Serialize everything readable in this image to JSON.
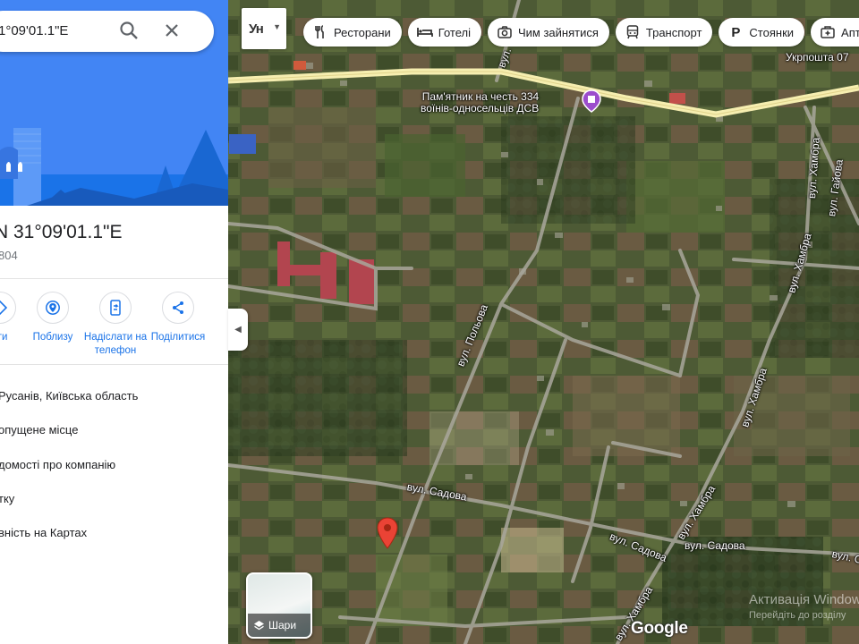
{
  "search": {
    "query": "1°09'01.1\"E"
  },
  "place": {
    "title": "N 31°09'01.1\"E",
    "subtitle": "804"
  },
  "actions": [
    {
      "label": "тти",
      "icon": "directions-icon"
    },
    {
      "label": "Поблизу",
      "icon": "nearby-icon"
    },
    {
      "label": "Надіслати на телефон",
      "icon": "send-to-phone-icon"
    },
    {
      "label": "Поділитися",
      "icon": "share-icon"
    }
  ],
  "info": [
    "Русанів, Київська область",
    "опущене місце",
    "домості про компанію",
    "тку",
    "вність на Картах"
  ],
  "toolbar": {
    "lang": "Ун",
    "chips": [
      {
        "label": "Ресторани",
        "icon": "restaurant-icon"
      },
      {
        "label": "Готелі",
        "icon": "hotel-icon"
      },
      {
        "label": "Чим зайнятися",
        "icon": "camera-icon"
      },
      {
        "label": "Транспорт",
        "icon": "transit-icon"
      },
      {
        "label": "Стоянки",
        "icon": "parking-icon"
      },
      {
        "label": "Апте",
        "icon": "pharmacy-icon"
      }
    ]
  },
  "map": {
    "poi": "Пам'ятник на честь 334 воїнів-односельців ДСВ",
    "poi_line1": "Пам'ятник на честь 334",
    "poi_line2": "воїнів-односельців ДСВ",
    "post": "Укрпошта 07",
    "streets": {
      "polova": "вул. Польова",
      "sadova1": "вул. Садова",
      "sadova2": "вул. Садова",
      "sadova3": "вул. Садова",
      "sadova4": "вул. Садова",
      "khambra1": "вул. Хамбра",
      "khambra2": "вул. Хамбра",
      "khambra3": "вул. Хамбра",
      "khambra4": "вул. Хамбра",
      "khambra5": "вул. Хамбра",
      "haiova": "вул. Гайова",
      "top": "вул."
    }
  },
  "layers_label": "Шари",
  "google": "Google",
  "watermark": {
    "line1": "Активація Windows",
    "line2": "Перейдіть до розділу"
  },
  "colors": {
    "accent": "#1a73e8",
    "hero": "#4285f4",
    "pin": "#ea4335",
    "main_road": "#f6eeb0"
  }
}
